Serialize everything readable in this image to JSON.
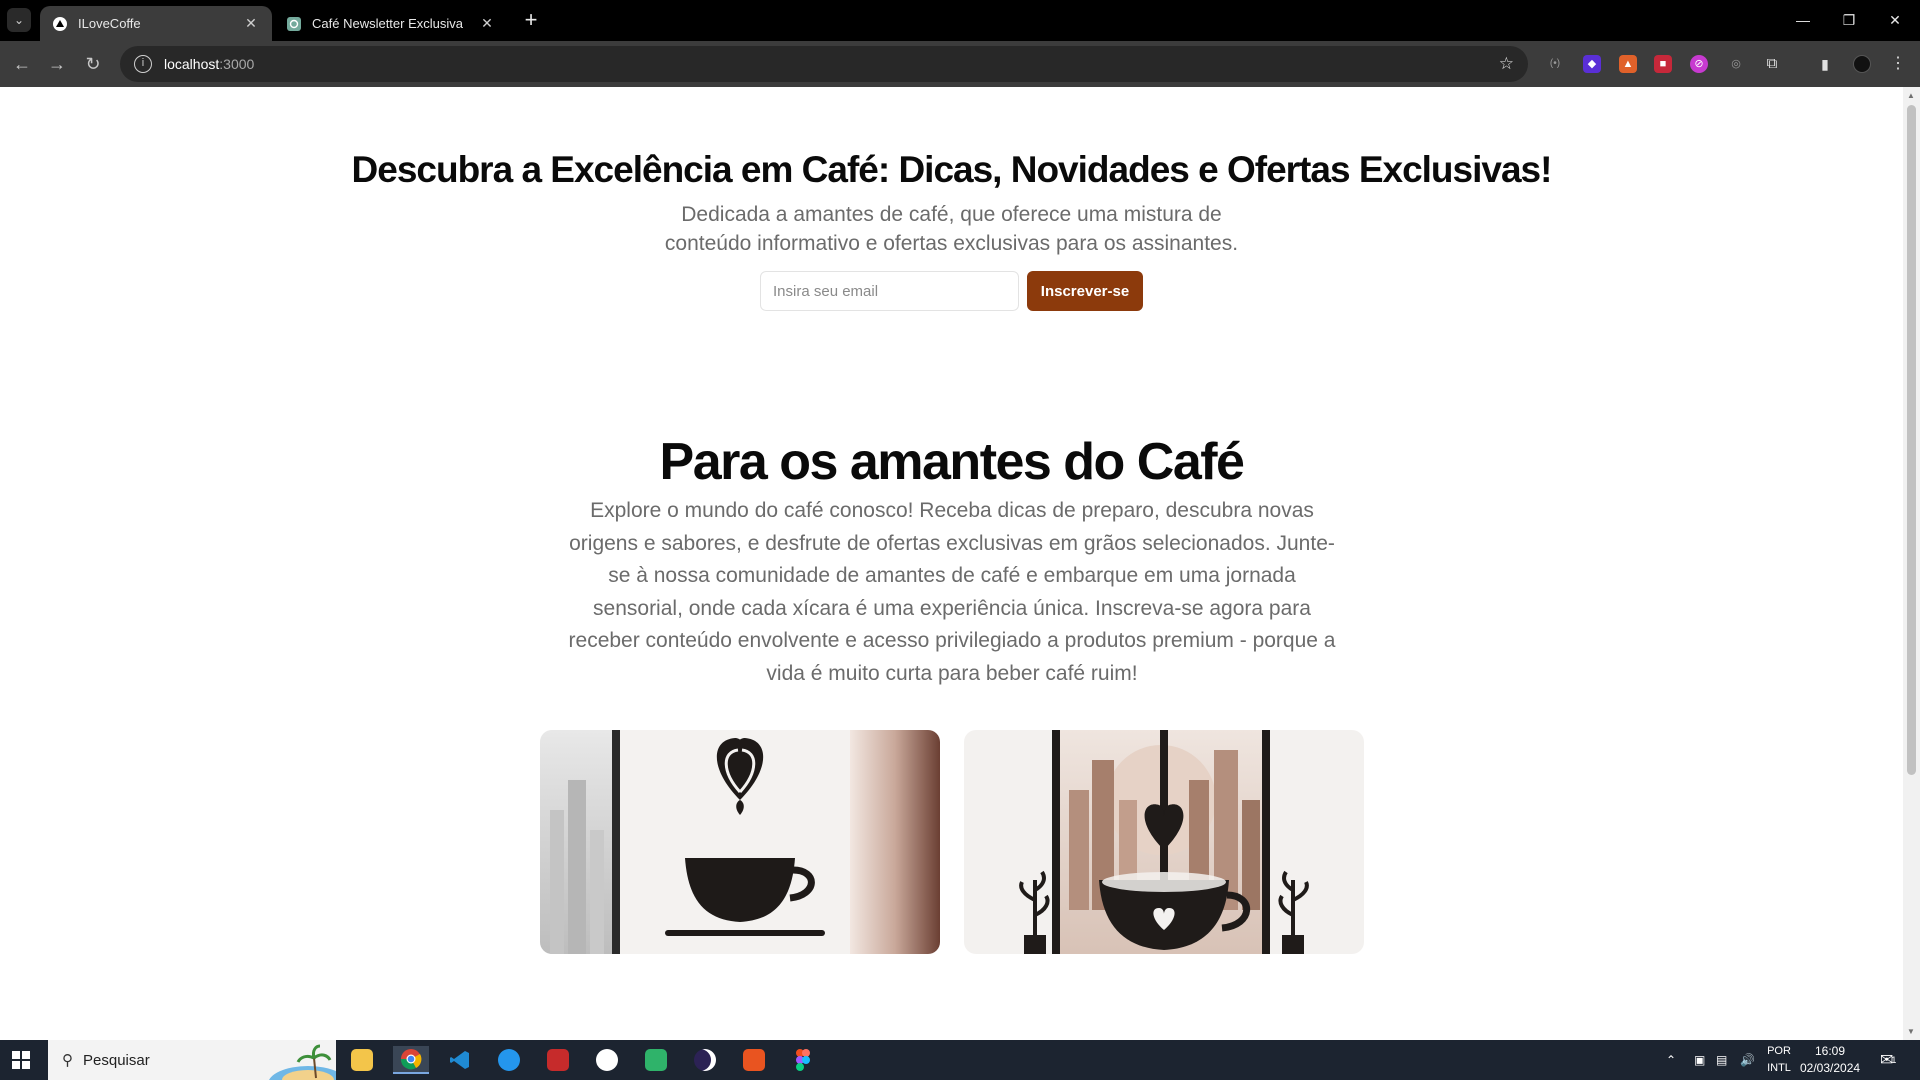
{
  "browser": {
    "tabs": [
      {
        "title": "ILoveCoffe",
        "active": true
      },
      {
        "title": "Café Newsletter Exclusiva",
        "active": false
      }
    ],
    "url_host": "localhost",
    "url_port": ":3000"
  },
  "hero": {
    "title": "Descubra a Excelência em Café: Dicas, Novidades e Ofertas Exclusivas!",
    "subtitle": "Dedicada a amantes de café, que oferece uma mistura de conteúdo informativo e ofertas exclusivas para os assinantes.",
    "email_placeholder": "Insira seu email",
    "subscribe_label": "Inscrever-se"
  },
  "section": {
    "title": "Para os amantes do Café",
    "body": "Explore o mundo do café conosco! Receba dicas de preparo, descubra novas origens e sabores, e desfrute de ofertas exclusivas em grãos selecionados. Junte-se à nossa comunidade de amantes de café e embarque em uma jornada sensorial, onde cada xícara é uma experiência única. Inscreva-se agora para receber conteúdo envolvente e acesso privilegiado a produtos premium - porque a vida é muito curta para beber café ruim!"
  },
  "taskbar": {
    "search_label": "Pesquisar",
    "lang_line1": "POR",
    "lang_line2": "INTL",
    "time": "16:09",
    "date": "02/03/2024",
    "notification_count": "1"
  },
  "colors": {
    "accent": "#8c3a0c",
    "text_muted": "#6b6b6b",
    "heading": "#0a0a0a"
  }
}
